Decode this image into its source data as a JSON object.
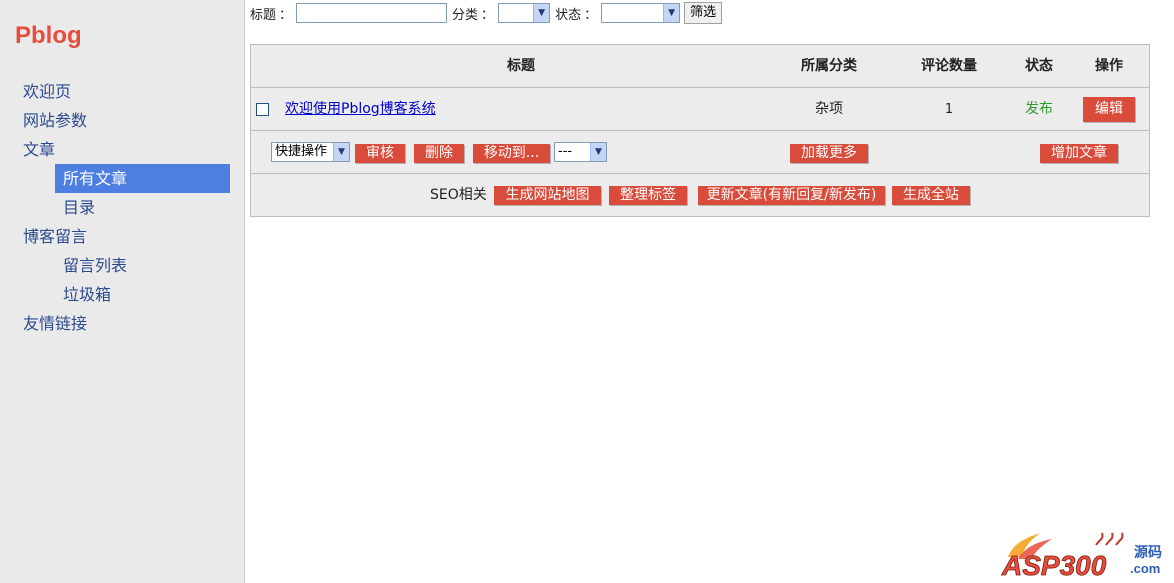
{
  "sidebar": {
    "logo": "Pblog",
    "items": [
      {
        "label": "欢迎页"
      },
      {
        "label": "网站参数"
      },
      {
        "label": "文章"
      },
      {
        "label": "所有文章"
      },
      {
        "label": "目录"
      },
      {
        "label": "博客留言"
      },
      {
        "label": "留言列表"
      },
      {
        "label": "垃圾箱"
      },
      {
        "label": "友情链接"
      }
    ]
  },
  "filter": {
    "title_label": "标题",
    "title_colon": "：",
    "title_value": "",
    "category_label": "分类",
    "category_colon": "：",
    "category_value": "",
    "status_label": "状态",
    "status_colon": "：",
    "status_value": "",
    "button": "筛选"
  },
  "table": {
    "headers": [
      "标题",
      "所属分类",
      "评论数量",
      "状态",
      "操作"
    ],
    "rows": [
      {
        "title": "欢迎使用Pblog博客系统",
        "category": "杂项",
        "comments": "1",
        "status": "发布",
        "action": "编辑"
      }
    ]
  },
  "actions": {
    "quick_select": "快捷操作",
    "review": "审核",
    "delete": "删除",
    "move_to": "移动到...",
    "move_target": "---",
    "load_more": "加载更多",
    "add_article": "增加文章"
  },
  "seo": {
    "label": "SEO相关",
    "buttons": [
      "生成网站地图",
      "整理标签",
      "更新文章(有新回复/新发布)",
      "生成全站"
    ]
  },
  "watermark": {
    "text": "ASP300",
    "suffix": "源码",
    "domain": ".com"
  },
  "colors": {
    "accent": "#d94b3b",
    "logo": "#e74c3c",
    "nav_active": "#4d7fe0",
    "status_published": "#2e9a2e"
  }
}
